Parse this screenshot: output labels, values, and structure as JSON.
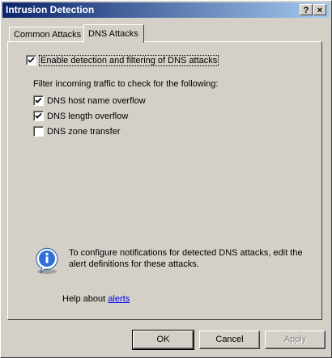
{
  "window": {
    "title": "Intrusion Detection",
    "help_label": "?",
    "close_label": "×"
  },
  "tabs": [
    {
      "label": "Common Attacks",
      "selected": false
    },
    {
      "label": "DNS Attacks",
      "selected": true
    }
  ],
  "dns_tab": {
    "enable_checkbox": {
      "label": "Enable detection and filtering of DNS attacks",
      "checked": true
    },
    "filter_heading": "Filter incoming traffic to check for the following:",
    "options": [
      {
        "label": "DNS host name overflow",
        "checked": true
      },
      {
        "label": "DNS length overflow",
        "checked": true
      },
      {
        "label": "DNS zone transfer",
        "checked": false
      }
    ],
    "info_text": "To configure notifications for detected DNS attacks, edit the alert definitions for these attacks.",
    "help_prefix": "Help about ",
    "help_link": "alerts"
  },
  "buttons": {
    "ok": "OK",
    "cancel": "Cancel",
    "apply": "Apply"
  }
}
